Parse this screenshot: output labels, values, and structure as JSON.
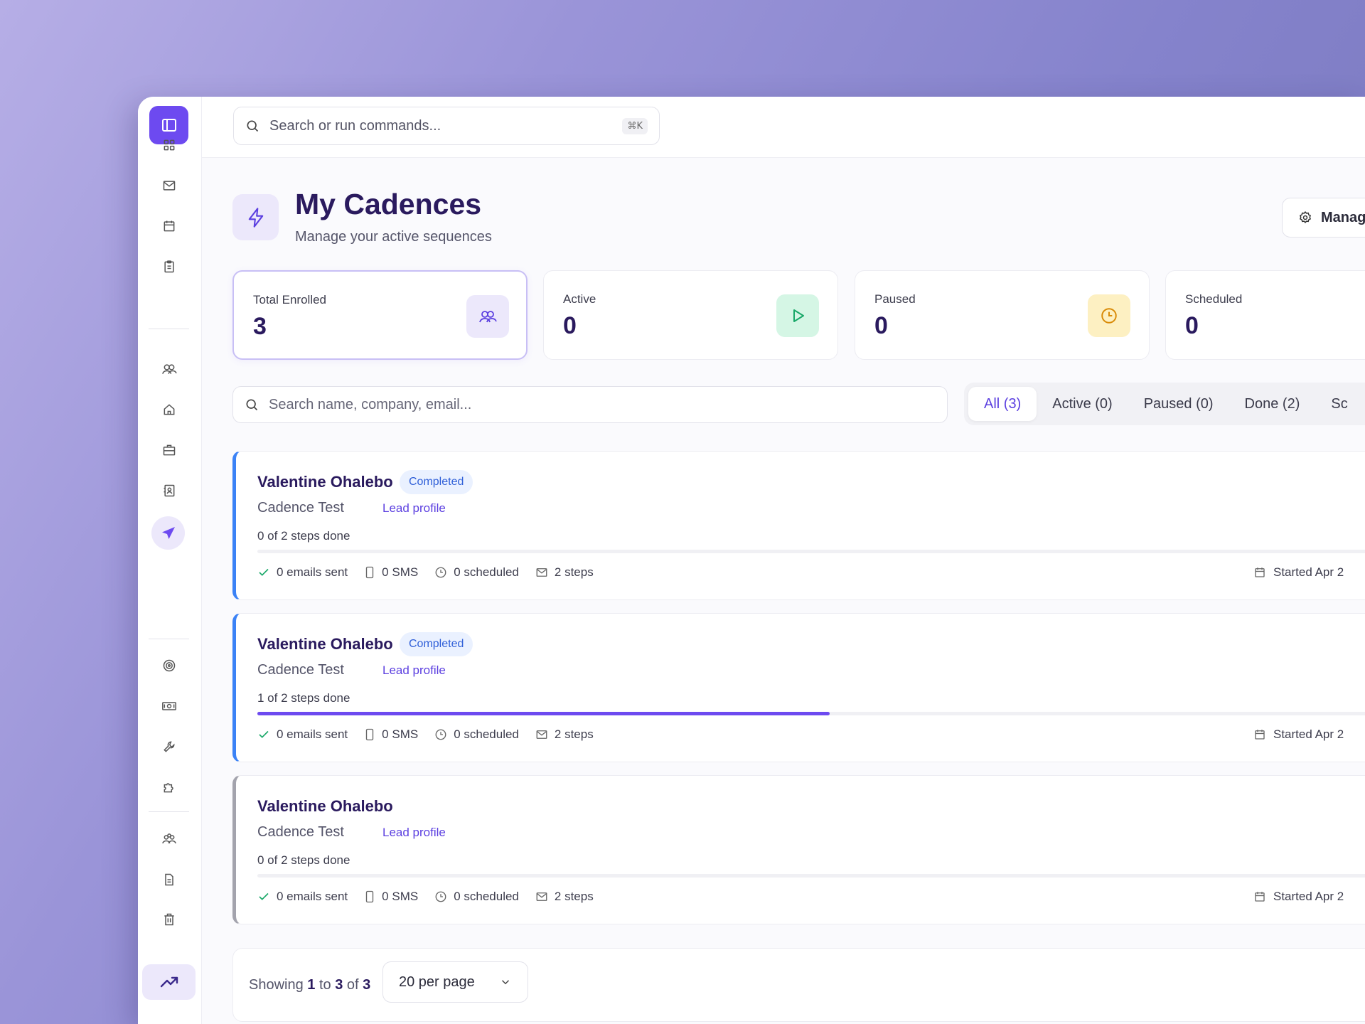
{
  "topbar": {
    "search_placeholder": "Search or run commands...",
    "shortcut": "⌘K"
  },
  "header": {
    "title": "My Cadences",
    "subtitle": "Manage your active sequences",
    "manage_label": "Manag"
  },
  "stats": [
    {
      "label": "Total Enrolled",
      "value": "3"
    },
    {
      "label": "Active",
      "value": "0"
    },
    {
      "label": "Paused",
      "value": "0"
    },
    {
      "label": "Scheduled",
      "value": "0"
    }
  ],
  "list": {
    "search_placeholder": "Search name, company, email...",
    "filters": [
      "All (3)",
      "Active (0)",
      "Paused (0)",
      "Done (2)",
      "Sc"
    ]
  },
  "cadences": [
    {
      "name": "Valentine Ohalebo",
      "badge": "Completed",
      "sequence": "Cadence Test",
      "link": "Lead profile",
      "steps_done": "0 of 2 steps done",
      "progress": 0,
      "emails": "0 emails sent",
      "sms": "0 SMS",
      "scheduled": "0 scheduled",
      "steps": "2 steps",
      "started": "Started Apr 2"
    },
    {
      "name": "Valentine Ohalebo",
      "badge": "Completed",
      "sequence": "Cadence Test",
      "link": "Lead profile",
      "steps_done": "1 of 2 steps done",
      "progress": 0.5,
      "emails": "0 emails sent",
      "sms": "0 SMS",
      "scheduled": "0 scheduled",
      "steps": "2 steps",
      "started": "Started Apr 2"
    },
    {
      "name": "Valentine Ohalebo",
      "badge": "",
      "sequence": "Cadence Test",
      "link": "Lead profile",
      "steps_done": "0 of 2 steps done",
      "progress": 0,
      "emails": "0 emails sent",
      "sms": "0 SMS",
      "scheduled": "0 scheduled",
      "steps": "2 steps",
      "started": "Started Apr 2"
    }
  ],
  "pagination": {
    "showing": "Showing",
    "from": "1",
    "to_word": "to",
    "to": "3",
    "of_word": "of",
    "total": "3",
    "per_page": "20 per page"
  },
  "colors": {
    "accent": "#6d4af0",
    "brand_dark": "#2a1a5e",
    "status_online": "#1fbf7a",
    "active_border": "#3b82f6",
    "inactive_border": "#a3a3ad"
  }
}
